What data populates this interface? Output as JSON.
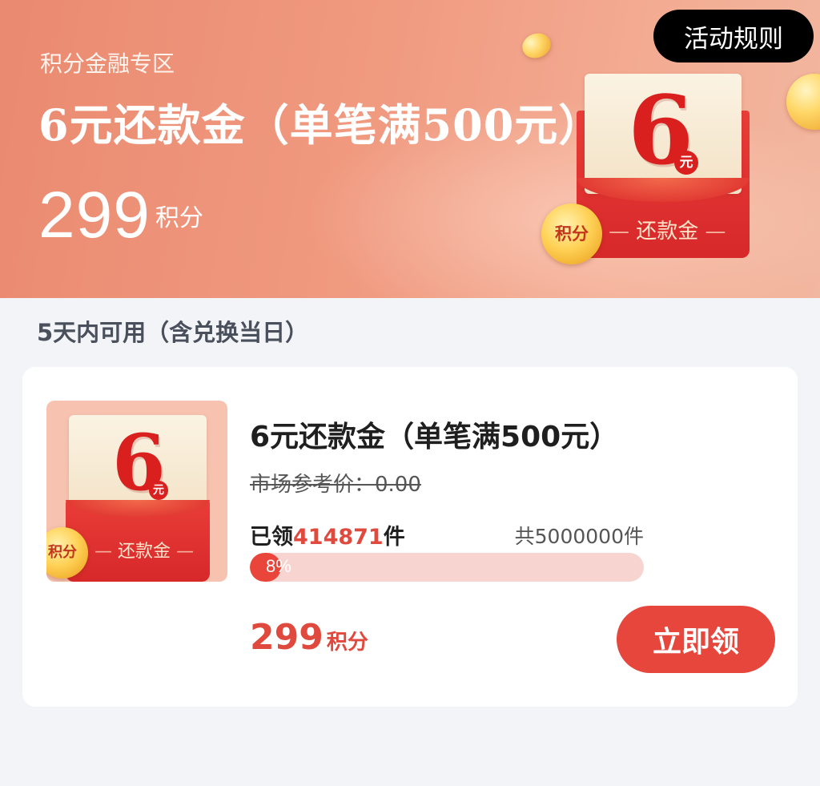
{
  "banner": {
    "zone_label": "积分金融专区",
    "title": "6元还款金（单笔满500元）",
    "price_value": "299",
    "price_unit": "积分",
    "rules_button": "活动规则",
    "illustration": {
      "amount": "6",
      "currency": "元",
      "label": "还款金",
      "coin_text": "积分"
    }
  },
  "validity": "5天内可用（含兑换当日）",
  "product": {
    "title": "6元还款金（单笔满500元）",
    "market_price": "市场参考价：0.00",
    "claimed_prefix": "已领",
    "claimed_count": "414871",
    "claimed_suffix": "件",
    "total": "共5000000件",
    "progress_percent": 8,
    "progress_text": "8%",
    "price_value": "299",
    "price_unit": "积分",
    "claim_button": "立即领",
    "thumbnail": {
      "amount": "6",
      "currency": "元",
      "label": "还款金",
      "coin_text": "积分"
    }
  },
  "colors": {
    "accent_red": "#e6463c",
    "banner_bg": "#ee9a80",
    "progress_track": "#f8d4d1"
  }
}
